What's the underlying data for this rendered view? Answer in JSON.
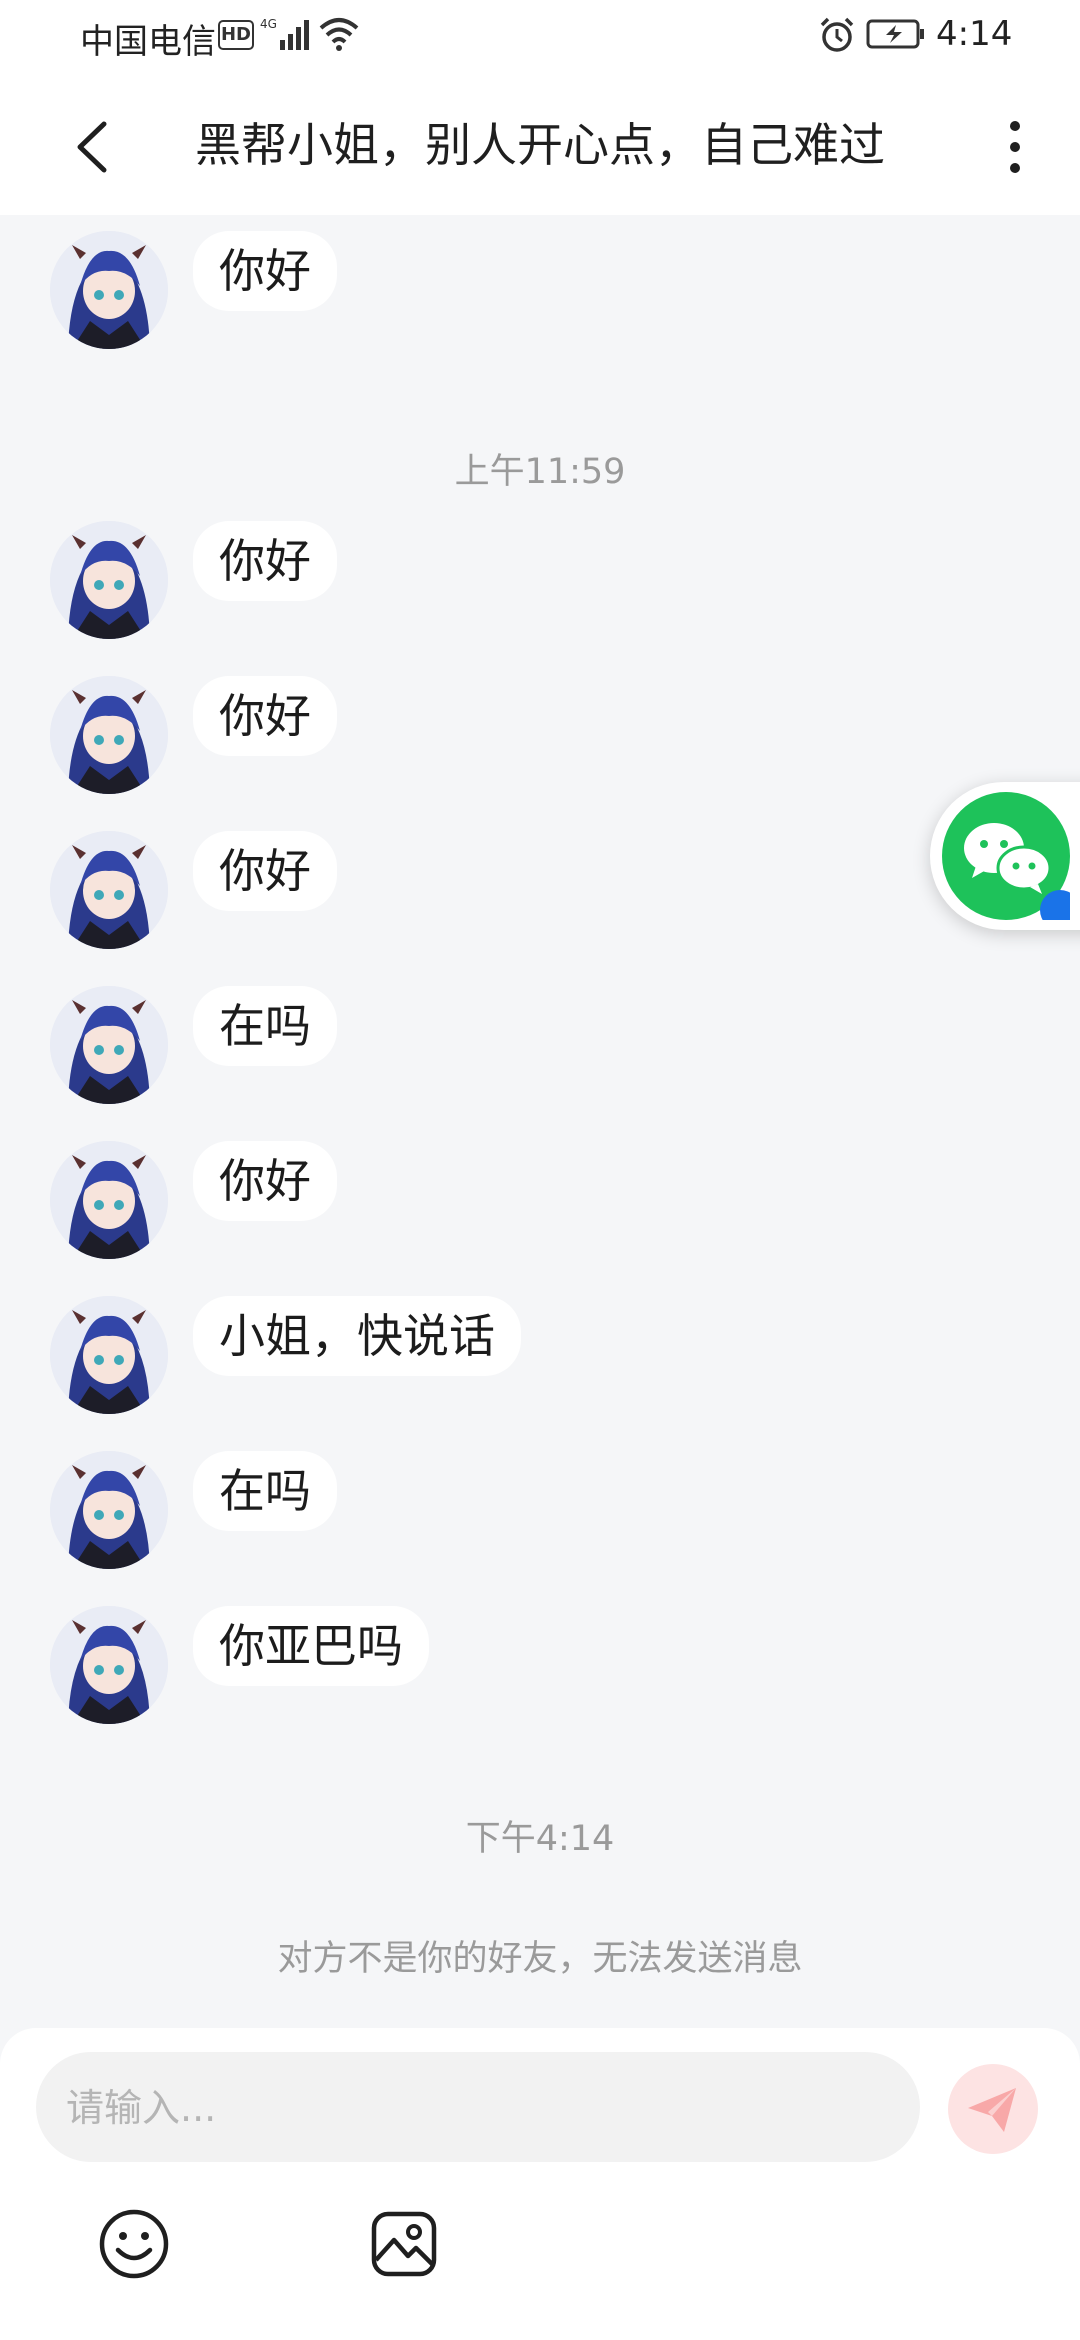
{
  "status_bar": {
    "carrier": "中国电信",
    "hd": "HD",
    "network": "4G",
    "time": "4:14"
  },
  "header": {
    "title": "黑帮小姐，别人开心点，自己难过",
    "back_icon": "chevron-left-icon",
    "more_icon": "more-vertical-icon"
  },
  "messages": [
    {
      "text": "你好"
    },
    {
      "text": "你好"
    },
    {
      "text": "你好"
    },
    {
      "text": "你好"
    },
    {
      "text": "在吗"
    },
    {
      "text": "你好"
    },
    {
      "text": "小姐，快说话"
    },
    {
      "text": "在吗"
    },
    {
      "text": "你亚巴吗"
    }
  ],
  "time_labels": [
    "上午11:59",
    "下午4:14"
  ],
  "notice": "对方不是你的好友，无法发送消息",
  "input": {
    "placeholder": "请输入..."
  },
  "colors": {
    "chat_bg": "#f5f6f8",
    "bubble_bg": "#ffffff",
    "send_bg": "#fde3e3",
    "send_icon": "#f8a8a8",
    "wechat_green": "#1ec25a"
  }
}
